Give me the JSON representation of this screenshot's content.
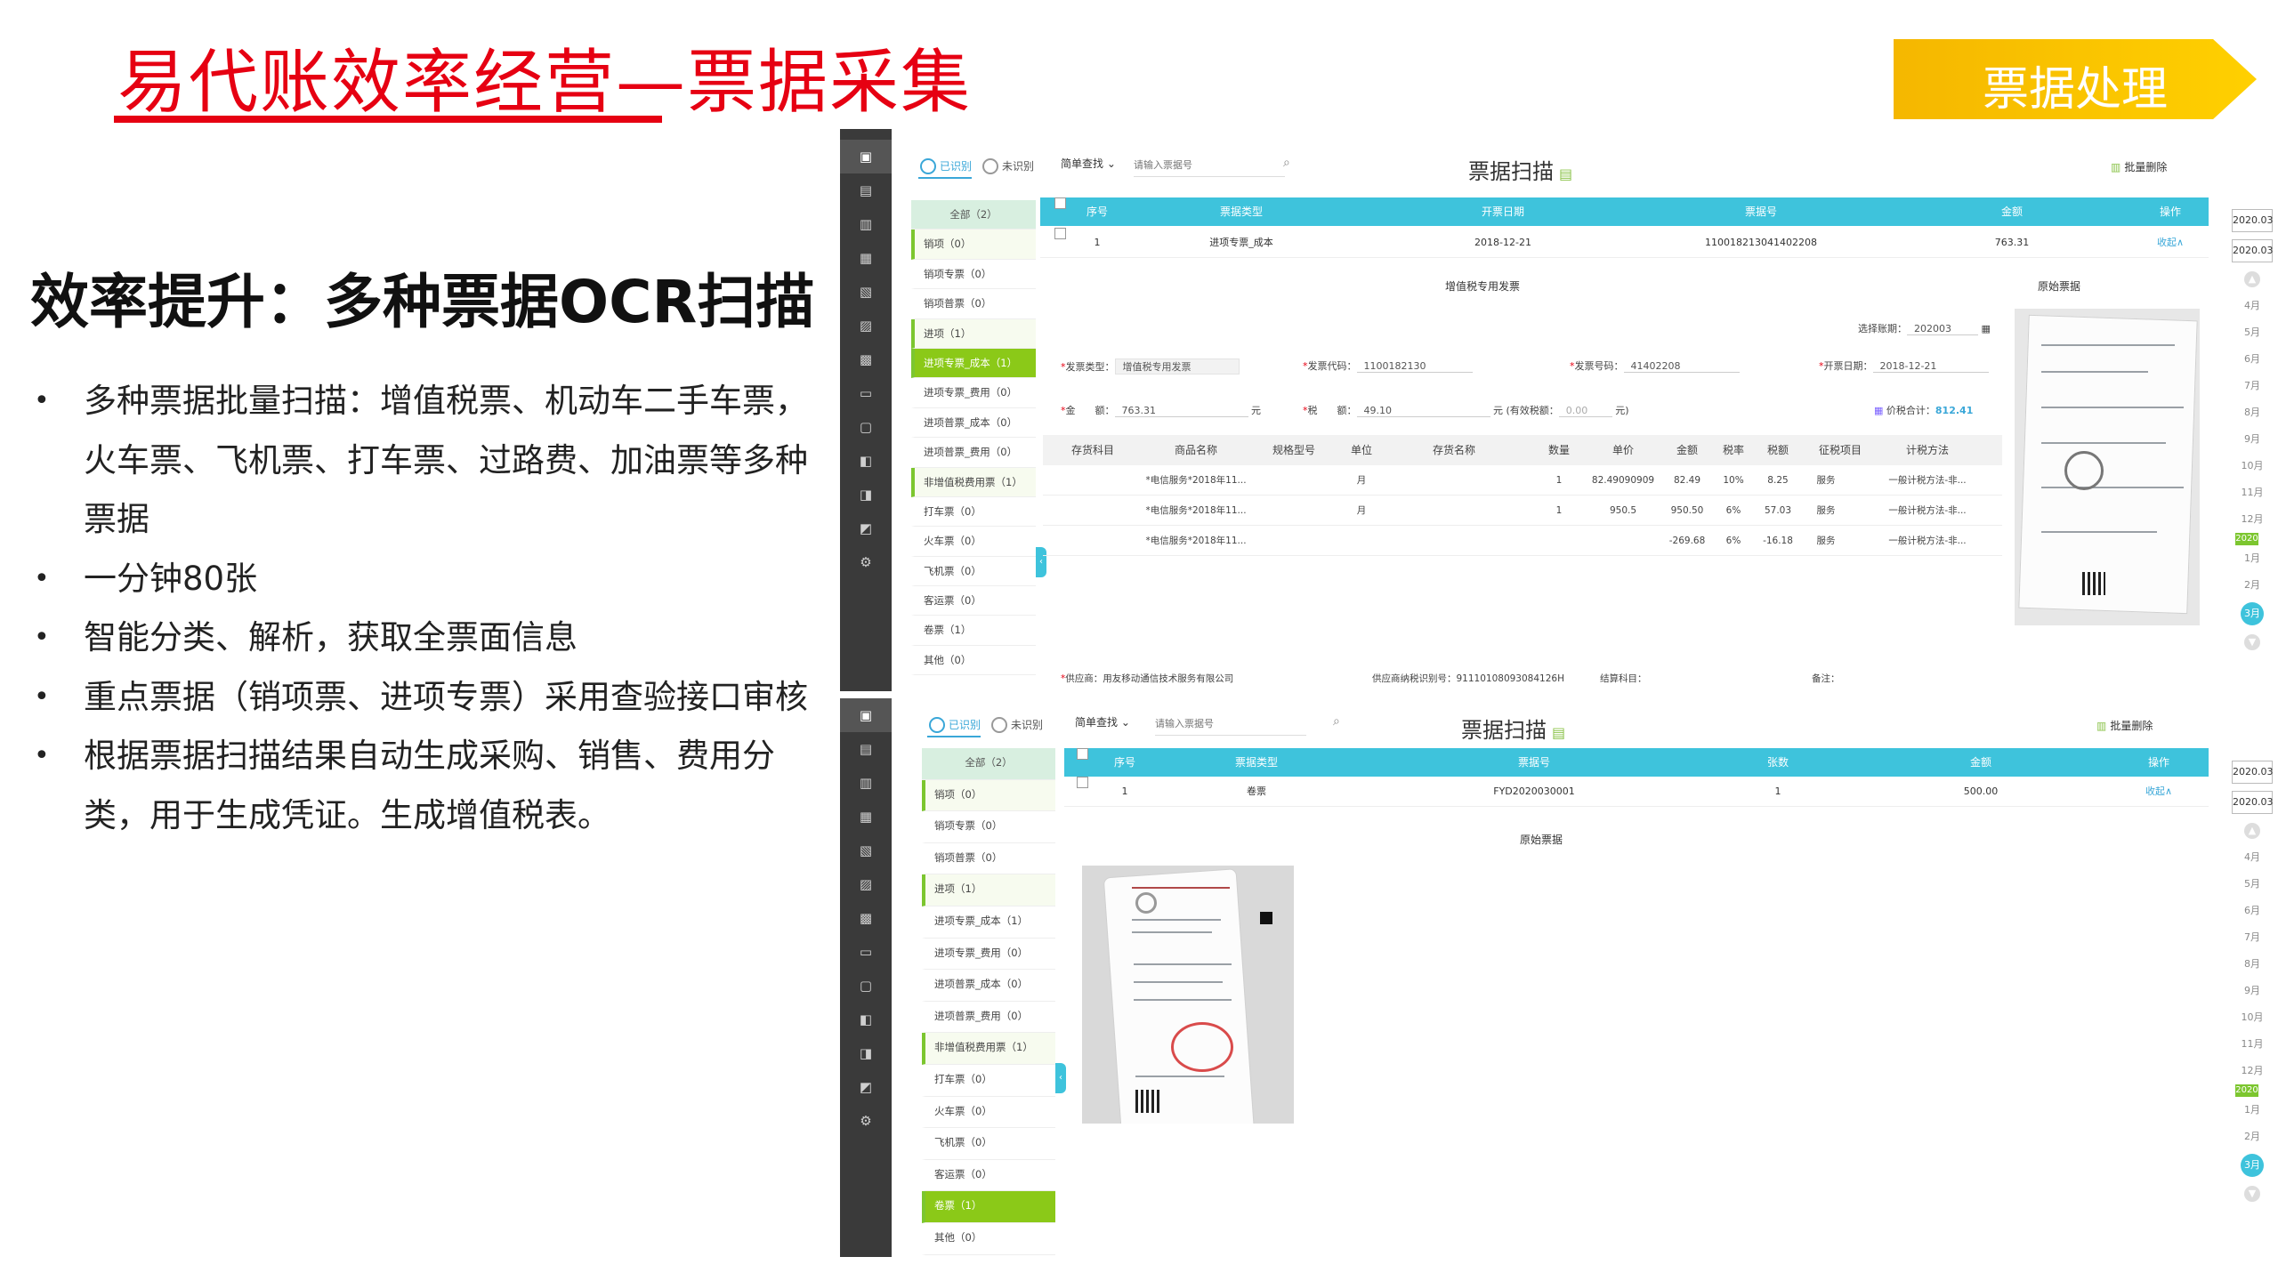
{
  "slide": {
    "title": "易代账效率经营—票据采集",
    "section_tag": "票据处理",
    "subhead": "效率提升：多种票据OCR扫描",
    "bullets": [
      "多种票据批量扫描：增值税票、机动车二手车票，火车票、飞机票、打车票、过路费、加油票等多种票据",
      "一分钟80张",
      "智能分类、解析，获取全票面信息",
      "重点票据（销项票、进项专票）采用查验接口审核",
      "根据票据扫描结果自动生成采购、销售、费用分类，用于生成凭证。生成增值税表。"
    ]
  },
  "colors": {
    "title_red": "#e60012",
    "tag_yellow": "#ffd000",
    "table_header_cyan": "#3ec3dc",
    "active_green": "#8bc918",
    "link_blue": "#3aa7d8",
    "rail_dark": "#3a3a3a"
  },
  "icons": {
    "rail": [
      "scan-icon",
      "document-icon",
      "invoice-icon",
      "chart-icon",
      "report-icon",
      "ledger-icon",
      "voucher-icon",
      "archive-icon",
      "wallet-icon",
      "image-icon",
      "stamp-icon",
      "calculator-icon",
      "settings-icon"
    ],
    "search": "search-icon",
    "batch_delete": "trash-icon",
    "heading_doc": "document-icon",
    "total": "total-icon"
  },
  "screen1": {
    "tabs": {
      "recognized": "已识别",
      "unrecognized": "未识别"
    },
    "search_mode": "简单查找",
    "search_placeholder": "请输入票据号",
    "heading": "票据扫描",
    "batch_delete": "批量删除",
    "categories": [
      "全部（2）",
      "销项（0）",
      "销项专票（0）",
      "销项普票（0）",
      "进项（1）",
      "进项专票_成本（1）",
      "进项专票_费用（0）",
      "进项普票_成本（0）",
      "进项普票_费用（0）",
      "非增值税费用票（1）",
      "打车票（0）",
      "火车票（0）",
      "飞机票（0）",
      "客运票（0）",
      "卷票（1）",
      "其他（0）"
    ],
    "columns": [
      "序号",
      "票据类型",
      "开票日期",
      "票据号",
      "金额",
      "操作"
    ],
    "row": {
      "index": "1",
      "type": "进项专票_成本",
      "date": "2018-12-21",
      "number": "110018213041402208",
      "amount": "763.31",
      "action": "收起∧"
    },
    "invoice_title": "增值税专用发票",
    "original_label": "原始票据",
    "period_label": "选择账期：",
    "period_value": "202003",
    "fields": {
      "type_label": "发票类型：",
      "type_value": "增值税专用发票",
      "code_label": "发票代码：",
      "code_value": "1100182130",
      "no_label": "发票号码：",
      "no_value": "41402208",
      "date_label": "开票日期：",
      "date_value": "2018-12-21",
      "amount_label": "金　　额：",
      "amount_value": "763.31",
      "yuan": "元",
      "tax_label": "税　　额：",
      "tax_value": "49.10",
      "valid_tax_label": "元 (有效税额：",
      "valid_tax_value": "0.00",
      "valid_tax_close": "元)",
      "total_label": "价税合计：",
      "total_value": "812.41"
    },
    "item_columns": [
      "存货科目",
      "商品名称",
      "规格型号",
      "单位",
      "存货名称",
      "数量",
      "单价",
      "金额",
      "税率",
      "税额",
      "征税项目",
      "计税方法"
    ],
    "items": [
      [
        "*电信服务*2018年11...",
        "月",
        "1",
        "82.49090909",
        "82.49",
        "10%",
        "8.25",
        "服务",
        "一般计税方法-非..."
      ],
      [
        "*电信服务*2018年11...",
        "月",
        "1",
        "950.5",
        "950.50",
        "6%",
        "57.03",
        "服务",
        "一般计税方法-非..."
      ],
      [
        "*电信服务*2018年11...",
        "",
        "",
        "",
        "-269.68",
        "6%",
        "-16.18",
        "服务",
        "一般计税方法-非..."
      ]
    ],
    "footer": {
      "supplier_label": "供应商：",
      "supplier_value": "用友移动通信技术服务有限公司",
      "taxid_label": "供应商纳税识别号：",
      "taxid_value": "91110108093084126H",
      "account_label": "结算科目：",
      "remark_label": "备注："
    },
    "dates": [
      "2020.03",
      "2020.03"
    ],
    "months": [
      "4月",
      "5月",
      "6月",
      "7月",
      "8月",
      "9月",
      "10月",
      "11月",
      "12月"
    ],
    "year_badge": "2020",
    "months_after": [
      "1月",
      "2月"
    ],
    "current_month": "3月"
  },
  "screen2": {
    "tabs": {
      "recognized": "已识别",
      "unrecognized": "未识别"
    },
    "search_mode": "简单查找",
    "search_placeholder": "请输入票据号",
    "heading": "票据扫描",
    "batch_delete": "批量删除",
    "categories": [
      "全部（2）",
      "销项（0）",
      "销项专票（0）",
      "销项普票（0）",
      "进项（1）",
      "进项专票_成本（1）",
      "进项专票_费用（0）",
      "进项普票_成本（0）",
      "进项普票_费用（0）",
      "非增值税费用票（1）",
      "打车票（0）",
      "火车票（0）",
      "飞机票（0）",
      "客运票（0）",
      "卷票（1）",
      "其他（0）"
    ],
    "columns": [
      "序号",
      "票据类型",
      "票据号",
      "张数",
      "金额",
      "操作"
    ],
    "row": {
      "index": "1",
      "type": "卷票",
      "number": "FYD2020030001",
      "count": "1",
      "amount": "500.00",
      "action": "收起∧"
    },
    "original_label": "原始票据",
    "dates": [
      "2020.03",
      "2020.03"
    ],
    "months": [
      "4月",
      "5月",
      "6月",
      "7月",
      "8月",
      "9月",
      "10月",
      "11月",
      "12月"
    ],
    "year_badge": "2020",
    "months_after": [
      "1月",
      "2月"
    ],
    "current_month": "3月"
  }
}
